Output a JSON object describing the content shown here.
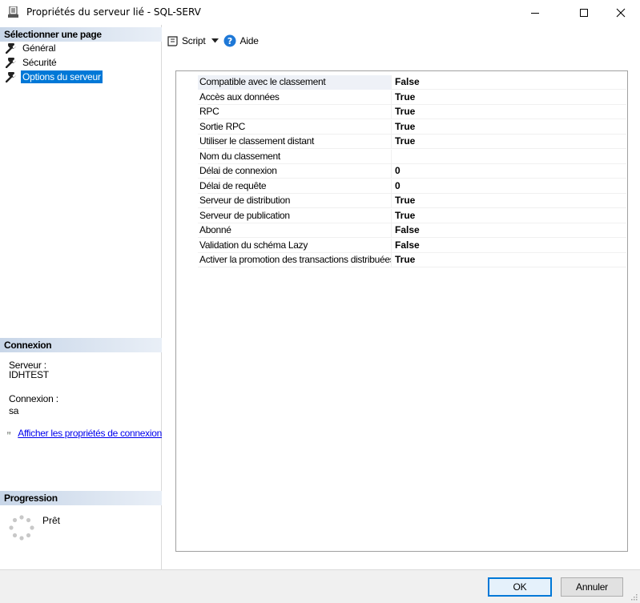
{
  "window": {
    "title": "Propriétés du serveur lié - SQL-SERV"
  },
  "left": {
    "select_page_header": "Sélectionner une page",
    "pages": [
      {
        "label": "Général",
        "icon": "wrench-icon"
      },
      {
        "label": "Sécurité",
        "icon": "wrench-icon"
      },
      {
        "label": "Options du serveur",
        "icon": "wrench-icon",
        "selected": true
      }
    ],
    "connection_header": "Connexion",
    "server_label": "Serveur :",
    "server_value": "IDHTEST",
    "connection_label": "Connexion :",
    "connection_value": "sa",
    "view_props_link": "Afficher les propriétés de connexion",
    "progress_header": "Progression",
    "progress_status": "Prêt"
  },
  "toolbar": {
    "script_label": "Script",
    "help_label": "Aide"
  },
  "properties": [
    {
      "name": "Compatible avec le classement",
      "value": "False"
    },
    {
      "name": "Accès aux données",
      "value": "True"
    },
    {
      "name": "RPC",
      "value": "True"
    },
    {
      "name": "Sortie RPC",
      "value": "True"
    },
    {
      "name": "Utiliser le classement distant",
      "value": "True"
    },
    {
      "name": "Nom du classement",
      "value": ""
    },
    {
      "name": "Délai de connexion",
      "value": "0"
    },
    {
      "name": "Délai de requête",
      "value": "0"
    },
    {
      "name": "Serveur de distribution",
      "value": "True"
    },
    {
      "name": "Serveur de publication",
      "value": "True"
    },
    {
      "name": "Abonné",
      "value": "False"
    },
    {
      "name": "Validation du schéma Lazy",
      "value": "False"
    },
    {
      "name": "Activer la promotion des transactions distribuées",
      "value": "True"
    }
  ],
  "buttons": {
    "ok": "OK",
    "cancel": "Annuler"
  },
  "colors": {
    "selection": "#0078d7",
    "link": "#0000ee",
    "header_gradient_start": "#c8d6e8",
    "help_icon": "#1e78d7"
  }
}
